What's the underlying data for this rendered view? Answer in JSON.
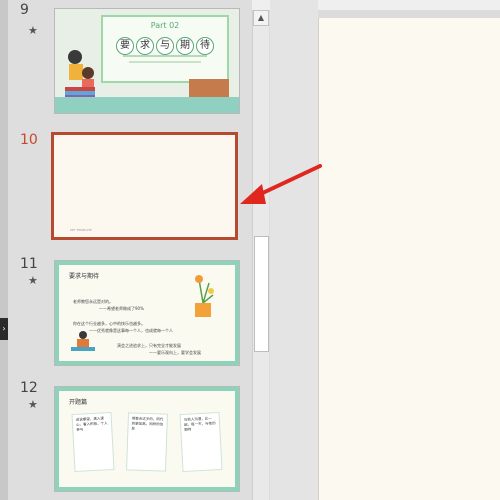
{
  "slides": [
    {
      "number": "9",
      "title_part": "Part 02",
      "title_chars": [
        "要",
        "求",
        "与",
        "期",
        "待"
      ]
    },
    {
      "number": "10",
      "footer": "PPT TEMPLATE"
    },
    {
      "number": "11",
      "heading": "要求与期待",
      "lines": [
        "老师教您永远是对的。",
        "——希望老师做成了90%",
        "你在这个行业越多，心中的快乐也越多。",
        "——优秀就像是这事每一个人，也成就每一个人",
        "演会之进追求上，只有完全才能发展",
        "——要乐观向上，要学会发展"
      ]
    },
    {
      "number": "12",
      "heading": "开题篇",
      "notes": [
        "说说期望，满入课心，看入积极，个人参与",
        "用整合达多的，同代的更加高，同样的信息",
        "与他人沟通，比一起，每一天，与他的期待"
      ]
    }
  ],
  "colors": {
    "accent": "#b64a30",
    "arrow": "#e0271f",
    "mint": "#8dd3bc"
  }
}
